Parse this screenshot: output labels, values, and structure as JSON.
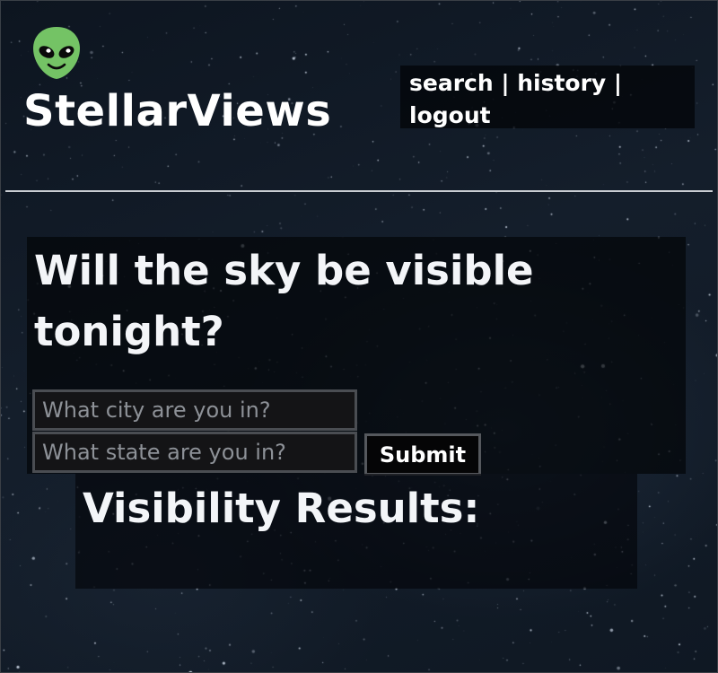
{
  "brand": {
    "name": "StellarViews",
    "logo_icon": "alien-head-icon",
    "logo_color": "#74c365"
  },
  "nav": {
    "search_label": "search",
    "history_label": "history",
    "logout_label": "logout",
    "separator": " | "
  },
  "hero": {
    "title": "Will the sky be visible tonight?"
  },
  "form": {
    "city_placeholder": "What city are you in?",
    "state_placeholder": "What state are you in?",
    "submit_label": "Submit"
  },
  "results": {
    "heading": "Visibility Results:"
  },
  "colors": {
    "background": "#121b27",
    "text": "#ffffff",
    "divider": "#c9cdd2"
  }
}
